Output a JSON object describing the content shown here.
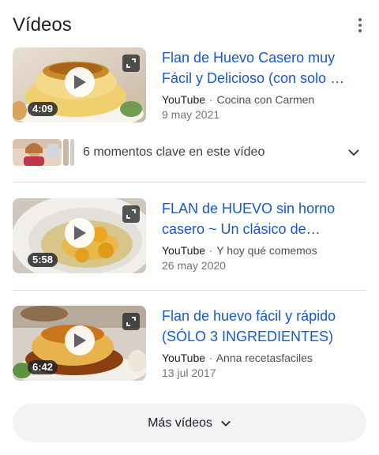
{
  "section": {
    "title": "Vídeos",
    "menu_icon": "more-vert-icon"
  },
  "videos": [
    {
      "title": "Flan de Huevo Casero muy Fácil y Delicioso (con solo …",
      "duration": "4:09",
      "source": "YouTube",
      "separator": "·",
      "channel": "Cocina con Carmen",
      "date": "9 may 2021"
    },
    {
      "title": "FLAN de HUEVO sin horno casero ~ Un clásico de…",
      "duration": "5:58",
      "source": "YouTube",
      "separator": "·",
      "channel": "Y hoy qué comemos",
      "date": "26 may 2020"
    },
    {
      "title": "Flan de huevo fácil y rápido (SÓLO 3 INGREDIENTES)",
      "duration": "6:42",
      "source": "YouTube",
      "separator": "·",
      "channel": "Anna recetasfaciles",
      "date": "13 jul 2017"
    }
  ],
  "key_moments": {
    "label": "6 momentos clave en este vídeo"
  },
  "more_button": {
    "label": "Más vídeos"
  },
  "colors": {
    "link": "#1558d6",
    "divider": "#dadce0",
    "button_bg": "#f1f3f4"
  }
}
